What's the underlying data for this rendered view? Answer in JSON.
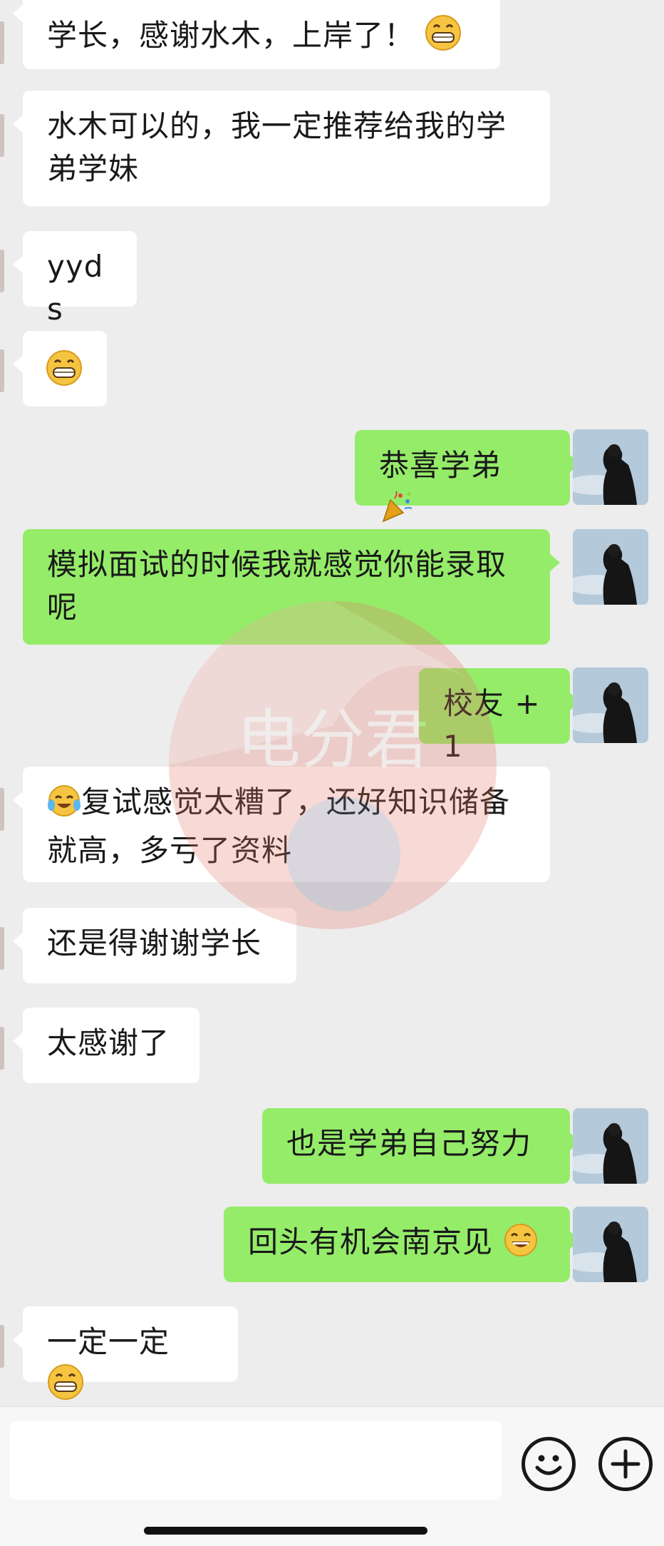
{
  "messages": [
    {
      "side": "in",
      "text": "学长，感谢水木，上岸了！",
      "emoji": "grin"
    },
    {
      "side": "in",
      "text": "水木可以的，我一定推荐给我的学弟学妹"
    },
    {
      "side": "in",
      "text": "yyds"
    },
    {
      "side": "in",
      "text": "",
      "emoji": "grin"
    },
    {
      "side": "out",
      "text": "恭喜学弟",
      "emoji": "party-popper"
    },
    {
      "side": "out",
      "text": "模拟面试的时候我就感觉你能录取呢"
    },
    {
      "side": "out",
      "text": "校友 +1"
    },
    {
      "side": "in",
      "text": "复试感觉太糟了，还好知识储备就高，多亏了资料",
      "emoji_lead": "crying-laughing"
    },
    {
      "side": "in",
      "text": "还是得谢谢学长"
    },
    {
      "side": "in",
      "text": "太感谢了"
    },
    {
      "side": "out",
      "text": "也是学弟自己努力"
    },
    {
      "side": "out",
      "text": "回头有机会南京见",
      "emoji": "smile"
    },
    {
      "side": "in",
      "text": "一定一定",
      "emoji": "grin"
    }
  ],
  "watermark": {
    "text": "电分君"
  },
  "input_bar": {
    "emoji_button_icon": "smiley-face-icon",
    "plus_button_icon": "plus-circle-icon"
  },
  "colors": {
    "background": "#ededed",
    "incoming_bubble": "#ffffff",
    "outgoing_bubble": "#95ec69"
  }
}
